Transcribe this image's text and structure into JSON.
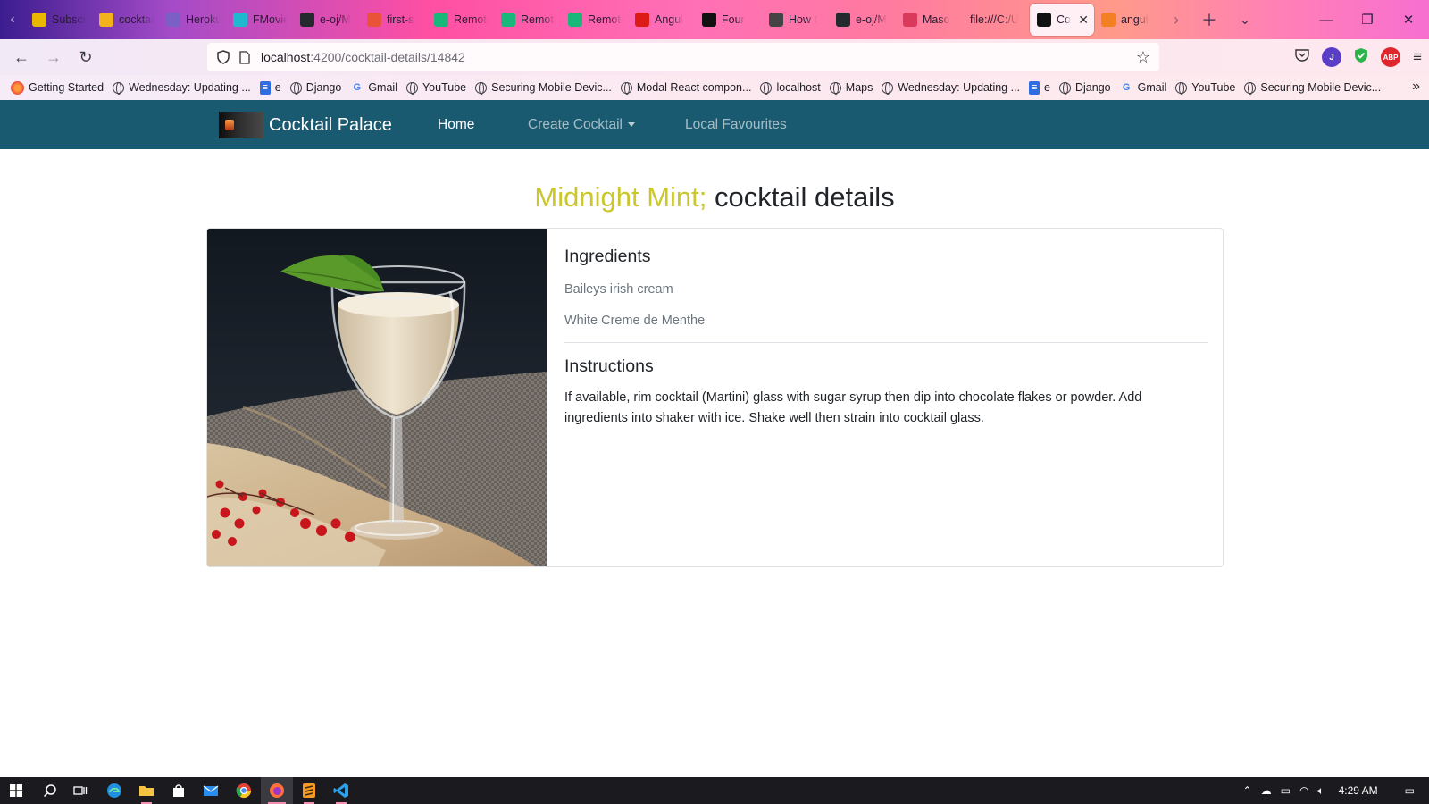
{
  "browser": {
    "tabs": [
      {
        "title": "Subscriptions",
        "icon": "youtube-tab-icon",
        "color": "#e9b800"
      },
      {
        "title": "cocktail",
        "icon": "cocktail-tab-icon",
        "color": "#f2b21b"
      },
      {
        "title": "Heroku",
        "icon": "heroku-tab-icon",
        "color": "#7b5fc4"
      },
      {
        "title": "FMovies",
        "icon": "fmovies-tab-icon",
        "color": "#1fb8cf"
      },
      {
        "title": "e-oj/M",
        "icon": "github-tab-icon",
        "color": "#24292e"
      },
      {
        "title": "first-s",
        "icon": "gitbook-tab-icon",
        "color": "#e8533a"
      },
      {
        "title": "Remote",
        "icon": "remote-tab-icon",
        "color": "#19b87a"
      },
      {
        "title": "Remote",
        "icon": "remote-tab-icon",
        "color": "#19b87a"
      },
      {
        "title": "Remote",
        "icon": "remote-tab-icon",
        "color": "#19b87a"
      },
      {
        "title": "Angul",
        "icon": "angular-tab-icon",
        "color": "#dd1b16"
      },
      {
        "title": "Four",
        "icon": "four-tab-icon",
        "color": "#111111"
      },
      {
        "title": "How t",
        "icon": "howto-tab-icon",
        "color": "#444444"
      },
      {
        "title": "e-oj/M",
        "icon": "github-tab-icon",
        "color": "#24292e"
      },
      {
        "title": "Maso",
        "icon": "dev-tab-icon",
        "color": "#d93a5c"
      },
      {
        "title": "file:///C:/U",
        "icon": "",
        "color": ""
      },
      {
        "title": "Co",
        "icon": "angular-tab-icon",
        "color": "#111111",
        "active": true
      },
      {
        "title": "angul",
        "icon": "stackoverflow-tab-icon",
        "color": "#f48024"
      }
    ],
    "url_host": "localhost",
    "url_path": ":4200/cocktail-details/14842",
    "bookmarks": [
      {
        "label": "Getting Started",
        "icon": "firefox-icon"
      },
      {
        "label": "Wednesday: Updating ...",
        "icon": "globe-icon"
      },
      {
        "label": "e",
        "icon": "doc-icon"
      },
      {
        "label": "Django",
        "icon": "globe-icon"
      },
      {
        "label": "Gmail",
        "icon": "google-icon"
      },
      {
        "label": "YouTube",
        "icon": "globe-icon"
      },
      {
        "label": "Securing Mobile Devic...",
        "icon": "globe-icon"
      },
      {
        "label": "Modal React compon...",
        "icon": "globe-icon"
      },
      {
        "label": "localhost",
        "icon": "globe-icon"
      },
      {
        "label": "Maps",
        "icon": "globe-icon"
      },
      {
        "label": "Wednesday: Updating ...",
        "icon": "globe-icon"
      },
      {
        "label": "e",
        "icon": "doc-icon"
      },
      {
        "label": "Django",
        "icon": "globe-icon"
      },
      {
        "label": "Gmail",
        "icon": "google-icon"
      },
      {
        "label": "YouTube",
        "icon": "globe-icon"
      },
      {
        "label": "Securing Mobile Devic...",
        "icon": "globe-icon"
      }
    ],
    "extensions": {
      "profile_initial": "J",
      "abp_label": "ABP"
    }
  },
  "site": {
    "brand": "Cocktail Palace",
    "nav": {
      "home": "Home",
      "create": "Create Cocktail",
      "favourites": "Local Favourites"
    }
  },
  "details": {
    "drink_name": "Midnight Mint;",
    "title_suffix": " cocktail details",
    "ingredients_heading": "Ingredients",
    "ingredients": [
      "Baileys irish cream",
      "White Creme de Menthe"
    ],
    "instructions_heading": "Instructions",
    "instructions": "If available, rim cocktail (Martini) glass with sugar syrup then dip into chocolate flakes or powder. Add ingredients into shaker with ice. Shake well then strain into cocktail glass."
  },
  "colors": {
    "site_nav": "#1a5a70",
    "drink_name": "#c9c729"
  },
  "taskbar": {
    "clock": "4:29 AM"
  }
}
